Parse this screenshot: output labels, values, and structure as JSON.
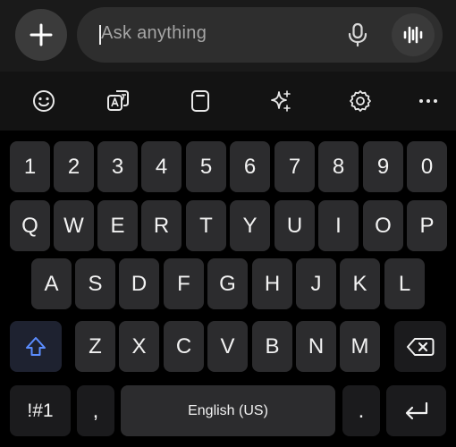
{
  "input": {
    "placeholder": "Ask anything"
  },
  "icons": {
    "add": "plus-icon",
    "mic": "microphone-icon",
    "voice": "voice-waveform-icon",
    "emoji": "emoji-icon",
    "translate": "translate-icon",
    "clipboard": "clipboard-icon",
    "ai": "sparkle-icon",
    "settings": "gear-icon",
    "more": "more-options-icon",
    "shift": "shift-arrow-icon",
    "backspace": "backspace-icon",
    "enter": "enter-return-icon"
  },
  "keyboard": {
    "row_numbers": [
      "1",
      "2",
      "3",
      "4",
      "5",
      "6",
      "7",
      "8",
      "9",
      "0"
    ],
    "row_top": [
      "Q",
      "W",
      "E",
      "R",
      "T",
      "Y",
      "U",
      "I",
      "O",
      "P"
    ],
    "row_home": [
      "A",
      "S",
      "D",
      "F",
      "G",
      "H",
      "J",
      "K",
      "L"
    ],
    "row_bottom": [
      "Z",
      "X",
      "C",
      "V",
      "B",
      "N",
      "M"
    ],
    "symbols_label": "!#1",
    "comma_label": ",",
    "space_label": "English (US)",
    "period_label": "."
  },
  "colors": {
    "accent_shift": "#5b8dff",
    "key_bg": "#2c2c2e",
    "special_key_bg": "#1b1b1d"
  }
}
